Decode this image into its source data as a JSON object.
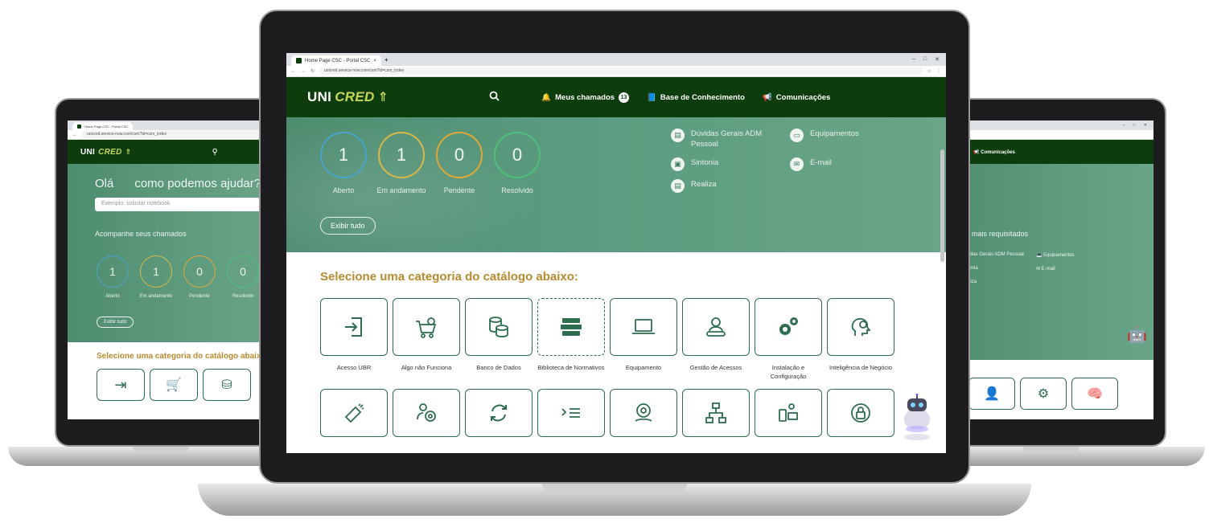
{
  "browser": {
    "tab_title": "Home Page CSC - Portal CSC",
    "url": "unicred.service-now.com/csm?id=csm_index",
    "window_controls": [
      "–",
      "□",
      "✕"
    ]
  },
  "app": {
    "logo_text": "UNI",
    "logo_text_em": "CRED",
    "nav": {
      "meus_chamados": "Meus chamados",
      "meus_chamados_count": "13",
      "base_conhecimento": "Base de Conhecimento",
      "comunicacoes": "Comunicações"
    }
  },
  "hero": {
    "greeting": "Olá",
    "question": "como podemos ajudar?",
    "search_placeholder": "Exemplo: solicitar notebook",
    "track_title": "Acompanhe seus chamados",
    "requested_title": "Os mais requisitados",
    "counters": [
      {
        "value": "1",
        "label": "Aberto",
        "color": "#49a3c9"
      },
      {
        "value": "1",
        "label": "Em andamento",
        "color": "#d6b94a"
      },
      {
        "value": "0",
        "label": "Pendente",
        "color": "#e0a73a"
      },
      {
        "value": "0",
        "label": "Resolvido",
        "color": "#4fbf7c"
      }
    ],
    "exibir_tudo": "Exibir tudo",
    "links": [
      {
        "label": "Dúvidas Gerais ADM Pessoal",
        "icon": "document-icon"
      },
      {
        "label": "Equipamentos",
        "icon": "laptop-icon"
      },
      {
        "label": "Sintonia",
        "icon": "screen-icon"
      },
      {
        "label": "E-mail",
        "icon": "mail-icon"
      },
      {
        "label": "Realiza",
        "icon": "document-icon"
      }
    ]
  },
  "catalog": {
    "title": "Selecione uma categoria do catálogo abaixo:",
    "row1": [
      {
        "label": "Acesso UBR",
        "icon": "login-icon"
      },
      {
        "label": "Algo não Funciona",
        "icon": "cart-icon"
      },
      {
        "label": "Banco de Dados",
        "icon": "database-icon"
      },
      {
        "label": "Biblioteca de Normativos",
        "icon": "books-icon"
      },
      {
        "label": "Equipamento",
        "icon": "laptop-icon"
      },
      {
        "label": "Gestão de Acessos",
        "icon": "user-key-icon"
      },
      {
        "label": "Instalação e Configuração",
        "icon": "gears-icon"
      },
      {
        "label": "Inteligência de Negócio",
        "icon": "brain-icon"
      }
    ],
    "row2": [
      {
        "icon": "megaphone-icon"
      },
      {
        "icon": "people-gear-icon"
      },
      {
        "icon": "refresh-icon"
      },
      {
        "icon": "list-icon"
      },
      {
        "icon": "money-gear-icon"
      },
      {
        "icon": "network-icon"
      },
      {
        "icon": "devices-icon"
      },
      {
        "icon": "lock-icon"
      }
    ]
  }
}
